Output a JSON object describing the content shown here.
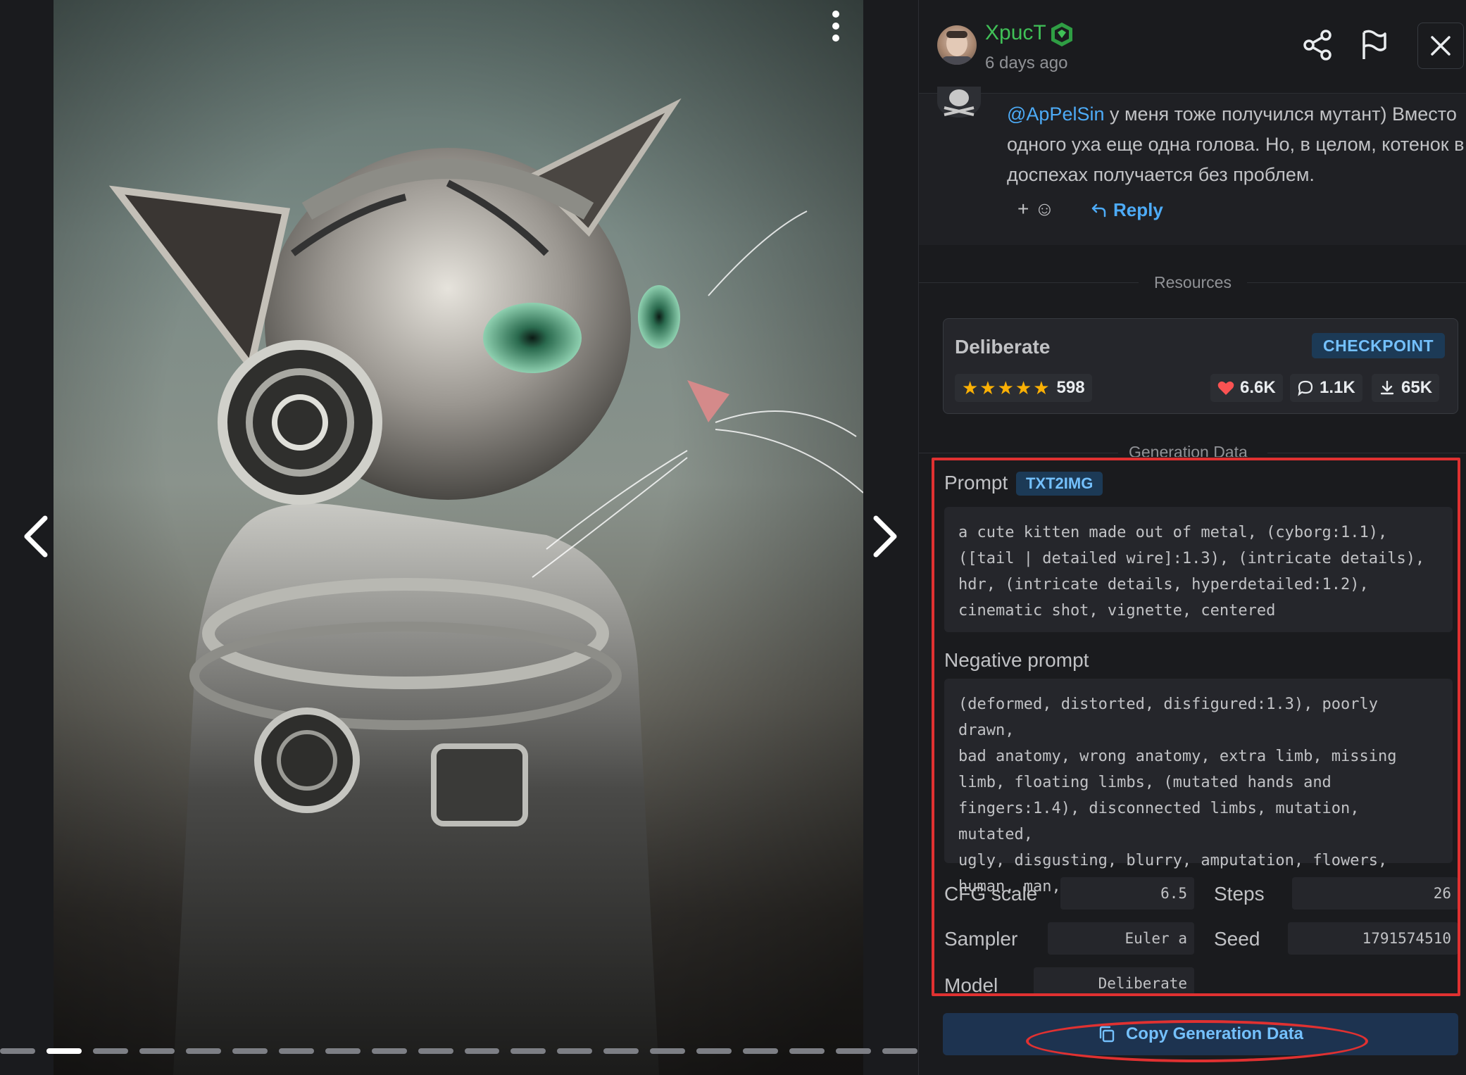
{
  "post": {
    "username": "XpucT",
    "time_ago": "6 days ago"
  },
  "comment": {
    "mention": "@ApPelSin",
    "text": " у меня тоже получился мутант) Вместо одного уха еще одна голова. Но, в целом, котенок в доспехах получается без проблем.",
    "react_label": "+ ☺",
    "reply_label": "Reply"
  },
  "resources": {
    "section_title": "Resources",
    "items": [
      {
        "name": "Deliberate",
        "type": "CHECKPOINT",
        "rating_stars": 5,
        "rating_count": "598",
        "likes": "6.6K",
        "comments": "1.1K",
        "downloads": "65K"
      }
    ]
  },
  "generation": {
    "section_title": "Generation Data",
    "prompt_label": "Prompt",
    "prompt_type": "TXT2IMG",
    "prompt": "a cute kitten made out of metal, (cyborg:1.1),\n([tail | detailed wire]:1.3), (intricate details),\nhdr, (intricate details, hyperdetailed:1.2),\ncinematic shot, vignette, centered",
    "negative_label": "Negative prompt",
    "negative_prompt": "(deformed, distorted, disfigured:1.3), poorly drawn,\nbad anatomy, wrong anatomy, extra limb, missing\nlimb, floating limbs, (mutated hands and\nfingers:1.4), disconnected limbs, mutation, mutated,\nugly, disgusting, blurry, amputation, flowers,\nhuman, man, woman",
    "params": {
      "cfg_label": "CFG scale",
      "cfg": "6.5",
      "steps_label": "Steps",
      "steps": "26",
      "sampler_label": "Sampler",
      "sampler": "Euler a",
      "seed_label": "Seed",
      "seed": "1791574510",
      "model_label": "Model",
      "model": "Deliberate"
    },
    "copy_label": "Copy Generation Data"
  },
  "gallery": {
    "segments": 20,
    "active_index": 1
  },
  "colors": {
    "accent_blue": "#4dabf7",
    "username_green": "#40c057",
    "highlight_red": "#e03131",
    "star_yellow": "#fab005",
    "heart_red": "#fa5252"
  },
  "icons": [
    "more-vertical-icon",
    "chevron-left-icon",
    "chevron-right-icon",
    "verified-badge-icon",
    "share-icon",
    "flag-icon",
    "close-icon",
    "reply-arrow-icon",
    "heart-icon",
    "comment-icon",
    "download-icon",
    "copy-icon"
  ]
}
